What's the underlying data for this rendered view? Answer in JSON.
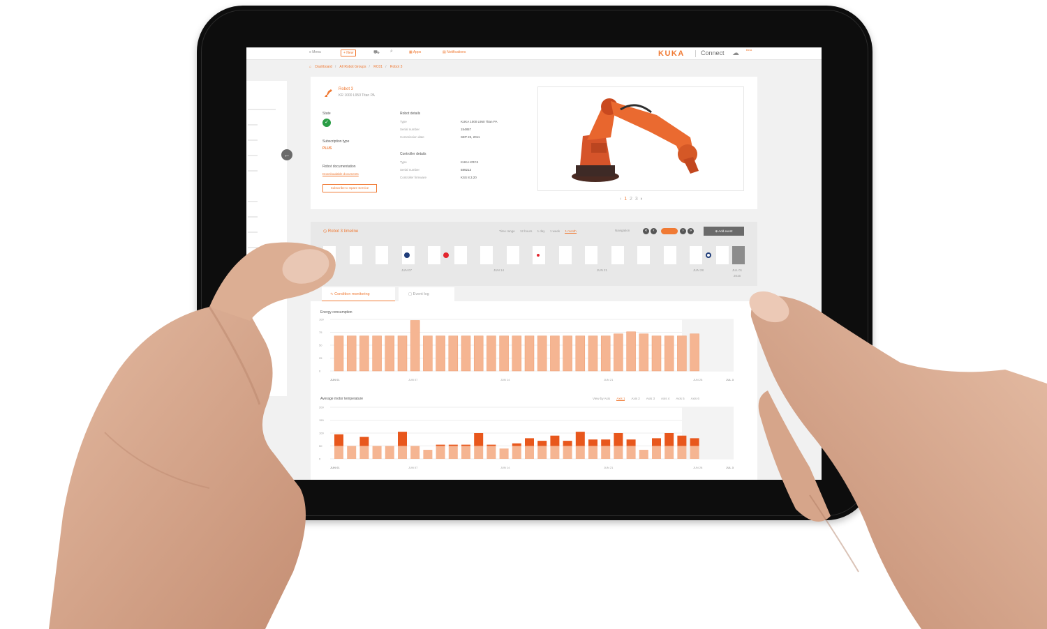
{
  "topbar": {
    "menu": "≡ Menu",
    "new_label": "+ New",
    "cart_icon": "cart-icon",
    "search_icon": "search-icon",
    "apps": "Apps",
    "notifications": "Notifications",
    "brand": "KUKA",
    "product": "Connect",
    "beta": "Beta"
  },
  "breadcrumb": [
    "Dashboard",
    "All Robot Groups",
    "RC01",
    "Robot 3"
  ],
  "robot": {
    "name": "Robot 3",
    "model": "KR 1000 L950 Titan PA",
    "state_label": "State",
    "subscription_label": "Subscription type",
    "subscription_value": "PLUS",
    "documentation_label": "Robot documentation",
    "documentation_link": "Downloadable documents",
    "subscribe_button": "Subscribe to Spare Service",
    "robot_details_label": "Robot details",
    "robot_details": [
      {
        "key": "Type",
        "value": "KUKA 1000 L950 Titan PA"
      },
      {
        "key": "Serial number",
        "value": "154857"
      },
      {
        "key": "Commission date",
        "value": "SEP 23, 2011"
      }
    ],
    "controller_details_label": "Controller details",
    "controller_details": [
      {
        "key": "Type",
        "value": "KUKA KRC4"
      },
      {
        "key": "Serial number",
        "value": "589213"
      },
      {
        "key": "Controller firmware",
        "value": "KSS 8.3.20"
      }
    ],
    "pager": {
      "prev": "‹",
      "pages": [
        "1",
        "2",
        "3"
      ],
      "next": "›",
      "active": "1"
    }
  },
  "timeline": {
    "title": "Robot 3 timeline",
    "time_range_label": "Time range",
    "ranges": [
      "12 hours",
      "1 day",
      "1 week",
      "1 month"
    ],
    "selected_range": "1 month",
    "navigation_label": "Navigation",
    "add_event": "Add event",
    "dates": [
      "JUN 01",
      "JUN 07",
      "JUN 14",
      "JUN 21",
      "JUN 28",
      "JUL 01",
      "2016"
    ],
    "colors": {
      "accent": "#f07a34",
      "blue": "#1f3d7a",
      "red": "#e3262e"
    }
  },
  "tabs": {
    "condition": "Condition monitoring",
    "event_log": "Event log"
  },
  "energy_chart": {
    "title": "Energy consumption"
  },
  "temp_chart": {
    "title": "Average motor temperature",
    "axes_label": "View by Axis",
    "axes": [
      "Axis 1",
      "Axis 2",
      "Axis 3",
      "Axis 4",
      "Axis 5",
      "Axis 6"
    ],
    "selected_axis": "Axis 1"
  },
  "chart_data": [
    {
      "type": "bar",
      "title": "Energy consumption",
      "x_labels": [
        "JUN 01",
        "JUN 07",
        "JUN 14",
        "JUN 21",
        "JUN 28",
        "JUL 3"
      ],
      "y_ticks": [
        0,
        25,
        50,
        75,
        100
      ],
      "ylim": [
        0,
        100
      ],
      "values": [
        68,
        68,
        68,
        68,
        68,
        68,
        98,
        68,
        68,
        68,
        68,
        68,
        68,
        68,
        68,
        68,
        68,
        68,
        68,
        68,
        68,
        68,
        72,
        76,
        72,
        68,
        68,
        68,
        72
      ],
      "color": "#f5b592"
    },
    {
      "type": "bar",
      "title": "Average motor temperature",
      "x_labels": [
        "JUN 01",
        "JUN 07",
        "JUN 14",
        "JUN 21",
        "JUN 28",
        "JUL 3"
      ],
      "y_ticks": [
        0,
        50,
        100,
        150,
        200
      ],
      "ylim": [
        0,
        200
      ],
      "series": [
        {
          "name": "",
          "values": [
            95,
            50,
            85,
            50,
            50,
            105,
            50,
            35,
            55,
            55,
            55,
            100,
            55,
            40,
            60,
            80,
            70,
            90,
            70,
            105,
            75,
            75,
            100,
            75,
            35,
            80,
            100,
            90,
            80
          ]
        }
      ],
      "base_values": [
        50,
        50,
        50,
        50,
        50,
        50,
        50,
        35,
        50,
        50,
        50,
        50,
        50,
        40,
        50,
        50,
        50,
        50,
        50,
        50,
        50,
        50,
        50,
        50,
        35,
        50,
        50,
        50,
        50
      ],
      "colors": {
        "dark": "#e8571c",
        "light": "#f5b592"
      }
    }
  ]
}
